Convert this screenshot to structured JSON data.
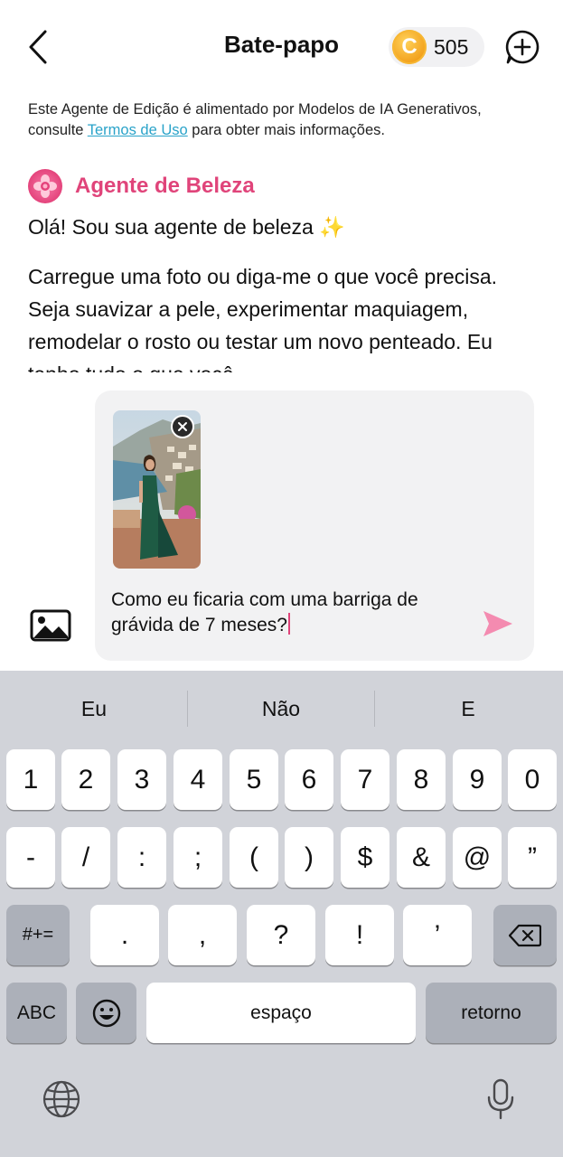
{
  "header": {
    "title": "Bate-papo",
    "coin_symbol": "C",
    "coin_count": "505"
  },
  "disclaimer": {
    "line1": "Este Agente de Edição é alimentado por Modelos de IA Generativos,",
    "line2_prefix": "consulte ",
    "terms_link": "Termos de Uso",
    "line2_suffix": " para obter mais informações."
  },
  "agent": {
    "name": "Agente de Beleza",
    "greeting": "Olá!  Sou sua agente de beleza ✨",
    "message": "Carregue uma foto ou diga-me o que você precisa. Seja suavizar a pele, experimentar maquiagem, remodelar o rosto ou testar um novo penteado. Eu tenho tudo o que você"
  },
  "composer": {
    "prompt": "Como eu ficaria com uma barriga de grávida de 7 meses?"
  },
  "keyboard": {
    "suggestions": [
      "Eu",
      "Não",
      "E"
    ],
    "row1": [
      "1",
      "2",
      "3",
      "4",
      "5",
      "6",
      "7",
      "8",
      "9",
      "0"
    ],
    "row2": [
      "-",
      "/",
      ":",
      ";",
      "(",
      ")",
      "$",
      "&",
      "@",
      "”"
    ],
    "row3_shift": "#+=",
    "row3": [
      ".",
      ",",
      "?",
      "!",
      "’"
    ],
    "abc": "ABC",
    "space": "espaço",
    "return": "retorno"
  },
  "colors": {
    "accent_pink": "#e0447a",
    "link_blue": "#2aa3c9",
    "coin_gold": "#f2a01c",
    "keyboard_bg": "#d1d3d9"
  },
  "icons": [
    "back-chevron-icon",
    "coin-icon",
    "new-chat-icon",
    "flower-icon",
    "close-icon",
    "gallery-icon",
    "send-icon",
    "backspace-icon",
    "emoji-icon",
    "globe-icon",
    "microphone-icon"
  ]
}
